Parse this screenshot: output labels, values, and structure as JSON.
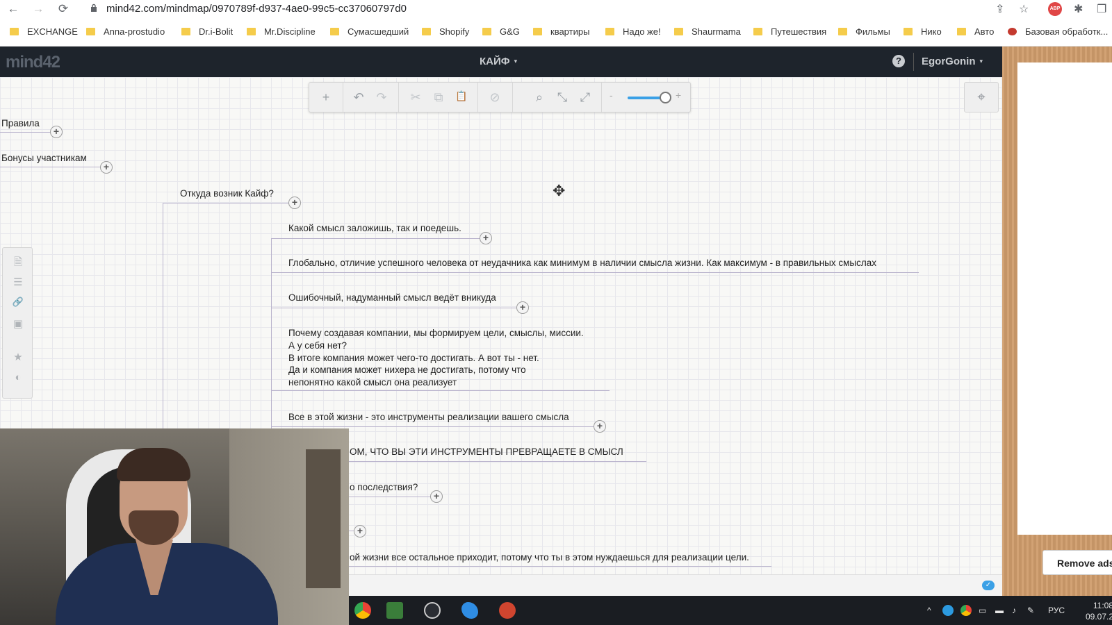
{
  "browser": {
    "url": "mind42.com/mindmap/0970789f-d937-4ae0-99c5-cc37060797d0",
    "nav": {
      "back": "←",
      "forward": "→",
      "reload": "⟳"
    },
    "icons": {
      "share": "⇪",
      "star": "☆",
      "extensions": "✱",
      "window": "❐"
    },
    "adblock_badge": "ABP",
    "bookmarks": [
      "EXCHANGE",
      "Anna-prostudio",
      "Dr.i-Bolit",
      "Mr.Discipline",
      "Сумасшедший",
      "Shopify",
      "G&G",
      "квартиры",
      "Надо же!",
      "Shaurmama",
      "Путешествия",
      "Фильмы",
      "Нико",
      "Авто",
      "Базовая обработк..."
    ]
  },
  "app": {
    "logo": "mind42",
    "map_title": "КАЙФ",
    "caret": "▾",
    "help": "?",
    "user": "EgorGonin"
  },
  "toolbar": {
    "add": "+",
    "undo": "↶",
    "redo": "↷",
    "cut": "✂",
    "copy": "⧉",
    "paste": "📋",
    "delete": "⊘",
    "search": "⌕",
    "collapse": "⤡",
    "expand": "⤢",
    "zoom_minus": "-",
    "zoom_plus": "+",
    "zoom_level_percent": 85,
    "center": "⌖"
  },
  "side_tools": {
    "note": "🗎",
    "list": "☰",
    "link": "🔗",
    "image": "▣",
    "star": "★",
    "palette": "◐"
  },
  "mindmap": {
    "nodes": [
      "Правила",
      "Бонусы участникам",
      "Откуда возник Кайф?",
      "Какой смысл заложишь, так и поедешь.",
      "Глобально, отличие успешного человека от неудачника как минимум в наличии смысла жизни. Как максимум - в правильных смыслах",
      "Ошибочный, надуманный смысл ведёт вникуда",
      "Почему создавая компании, мы формируем цели, смыслы, миссии.",
      "А у себя нет?",
      "В итоге компания может чего-то достигать. А вот ты - нет.",
      "Да и компания может нихера не достигать, потому что",
      "непонятно какой смысл она реализует",
      "Все в этой жизни - это инструменты реализации вашего смысла",
      "ОМ, ЧТО ВЫ ЭТИ ИНСТРУМЕНТЫ ПРЕВРАЩАЕТЕ В СМЫСЛ",
      "о последствия?",
      "ой жизни все остальное приходит, потому что ты в этом нуждаешься для реализации цели."
    ],
    "expand_symbol": "+"
  },
  "ads": {
    "remove_label": "Remove ads"
  },
  "taskbar": {
    "language": "РУС",
    "time": "11:08",
    "date": "09.07.2"
  },
  "colors": {
    "header_bg": "#1e242c",
    "connector": "#b9b3cc",
    "accent": "#3aa0e6"
  }
}
